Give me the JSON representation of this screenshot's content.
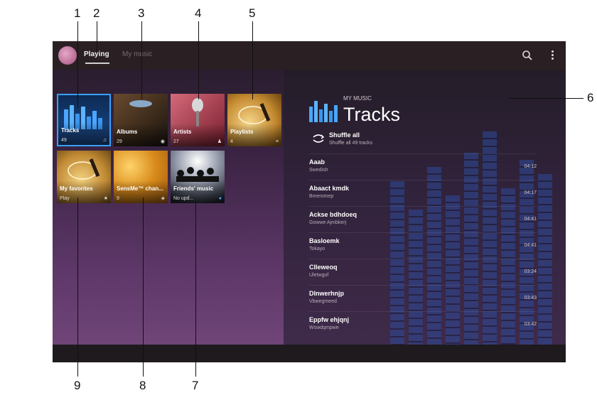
{
  "callouts": [
    "1",
    "2",
    "3",
    "4",
    "5",
    "6",
    "7",
    "8",
    "9"
  ],
  "header": {
    "tabs": [
      {
        "label": "Playing"
      },
      {
        "label": "My music"
      }
    ]
  },
  "tiles": [
    {
      "label": "Tracks",
      "count": "49"
    },
    {
      "label": "Albums",
      "count": "29"
    },
    {
      "label": "Artists",
      "count": "27"
    },
    {
      "label": "Playlists",
      "count": "4"
    },
    {
      "label": "My favorites",
      "count": "Play"
    },
    {
      "label": "SensMe™ chan...",
      "count": "9"
    },
    {
      "label": "Friends' music",
      "count": "No upd..."
    }
  ],
  "right_panel": {
    "eyebrow": "MY MUSIC",
    "title": "Tracks",
    "shuffle_label": "Shuffle all",
    "shuffle_sub": "Shuffle all 49 tracks"
  },
  "tracks": [
    {
      "name": "Aaab",
      "artist": "Swedish",
      "duration": "04:12"
    },
    {
      "name": "Abaact kmdk",
      "artist": "Bmeromep",
      "duration": "04:17"
    },
    {
      "name": "Ackse bdhdoeq",
      "artist": "Gowwe Ajmbkerj",
      "duration": "04:41"
    },
    {
      "name": "Basloemk",
      "artist": "Tokayo",
      "duration": "04:41"
    },
    {
      "name": "Clleweoq",
      "artist": "Uletwgof",
      "duration": "03:24"
    },
    {
      "name": "Dlnwerhnjp",
      "artist": "Vbwegmeed",
      "duration": "03:43"
    },
    {
      "name": "Eppfw ehjqnj",
      "artist": "Wswdqmpwe",
      "duration": "03:42"
    }
  ]
}
